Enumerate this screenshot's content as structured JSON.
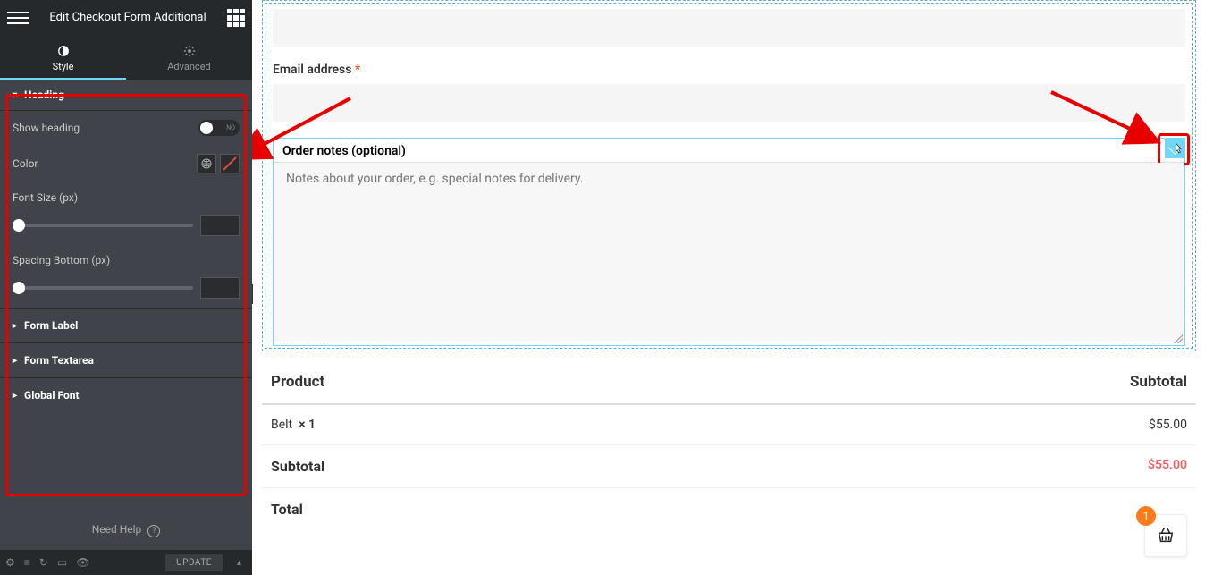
{
  "header": {
    "title": "Edit Checkout Form Additional"
  },
  "tabs": {
    "style": "Style",
    "advanced": "Advanced"
  },
  "panel": {
    "section": "Heading",
    "show_heading_label": "Show heading",
    "show_heading_value": "NO",
    "color_label": "Color",
    "font_size_label": "Font Size (px)",
    "spacing_label": "Spacing Bottom (px)",
    "sections": {
      "form_label": "Form Label",
      "form_textarea": "Form Textarea",
      "global_font": "Global Font"
    }
  },
  "help": {
    "text": "Need Help",
    "q": "?"
  },
  "footer": {
    "update": "UPDATE",
    "caret": "▴"
  },
  "canvas": {
    "email_label": "Email address",
    "order_notes_label": "Order notes (optional)",
    "order_notes_placeholder": "Notes about your order, e.g. special notes for delivery.",
    "summary": {
      "product": "Product",
      "subtotal_head": "Subtotal",
      "item_name": "Belt",
      "item_qty": "× 1",
      "item_price": "$55.00",
      "subtotal_label": "Subtotal",
      "subtotal_value": "$55.00",
      "total_label": "Total"
    },
    "cart_count": "1"
  }
}
